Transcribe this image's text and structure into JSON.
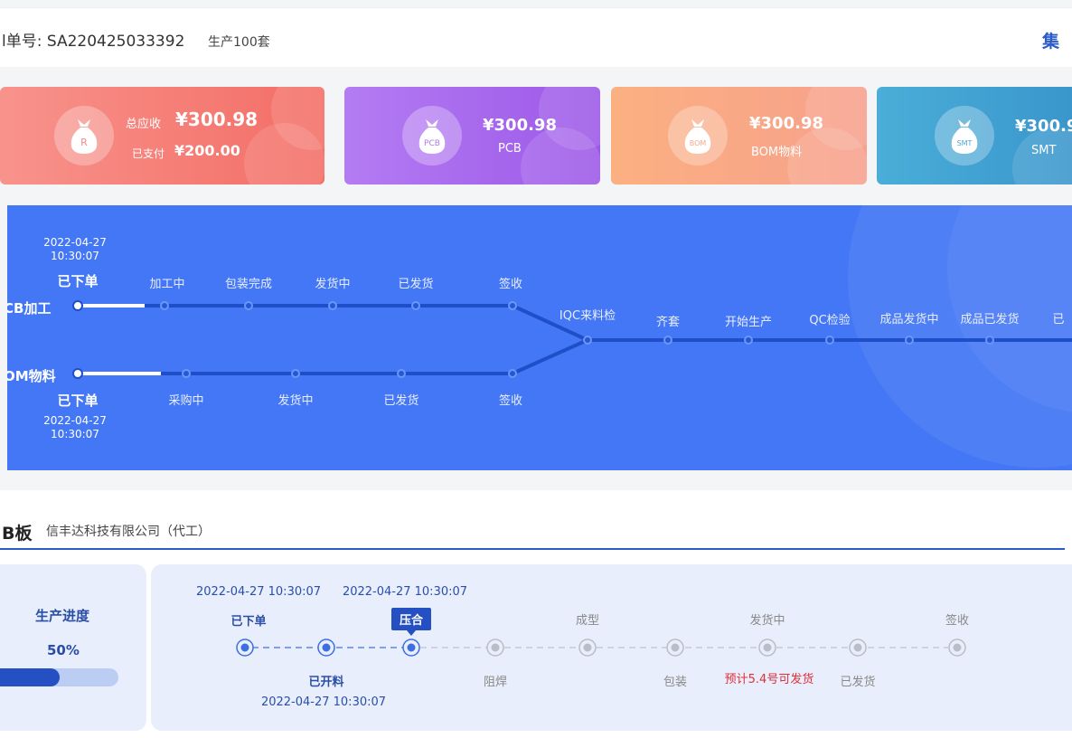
{
  "header": {
    "order_no": "l单号: SA220425033392",
    "qty": "生产100套",
    "right_title": "集"
  },
  "cards": [
    {
      "title": "总应收",
      "amount": "¥300.98",
      "sub_label": "已支付",
      "sub_amount": "¥200.00",
      "icon": "money-bag-icon",
      "icon_text": "R",
      "color": "#f36e66"
    },
    {
      "amount": "¥300.98",
      "label": "PCB",
      "icon": "money-bag-icon",
      "icon_text": "PCB",
      "color": "#9d58e8"
    },
    {
      "amount": "¥300.98",
      "label": "BOM物料",
      "icon": "money-bag-icon",
      "icon_text": "BOM",
      "color": "#f7a08c"
    },
    {
      "amount": "¥300.9",
      "label": "SMT",
      "icon": "money-bag-icon",
      "icon_text": "SMT",
      "color": "#3a96cc"
    }
  ],
  "flow": {
    "pcb_row": {
      "label": "CB加工",
      "date": "2022-04-27",
      "time": "10:30:07",
      "status": "已下单",
      "steps": [
        "加工中",
        "包装完成",
        "发货中",
        "已发货",
        "签收"
      ]
    },
    "bom_row": {
      "label": "OM物料",
      "date": "2022-04-27",
      "time": "10:30:07",
      "status": "已下单",
      "steps": [
        "采购中",
        "发货中",
        "已发货",
        "签收"
      ]
    },
    "merged_steps": [
      "IQC来料检",
      "齐套",
      "开始生产",
      "QC检验",
      "成品发货中",
      "成品已发货",
      "已"
    ]
  },
  "pcb_section": {
    "title": "B板",
    "subtitle": "信丰达科技有限公司（代工）",
    "progress": {
      "title": "生产进度",
      "percent_text": "50%",
      "value": 0.5
    },
    "steps": {
      "top_dates": [
        "2022-04-27  10:30:07",
        "2022-04-27  10:30:07"
      ],
      "top_labels": [
        "已下单",
        "压合",
        "成型",
        "发货中",
        "签收"
      ],
      "bottom_labels": [
        "已开料",
        "阻焊",
        "包装",
        "预计5.4号可发货",
        "已发货"
      ],
      "bottom_date": "2022-04-27   10:30:07"
    }
  },
  "colors": {
    "primary": "#2450c4",
    "flow_bg": "#4477f5",
    "warn": "#e0303a"
  }
}
